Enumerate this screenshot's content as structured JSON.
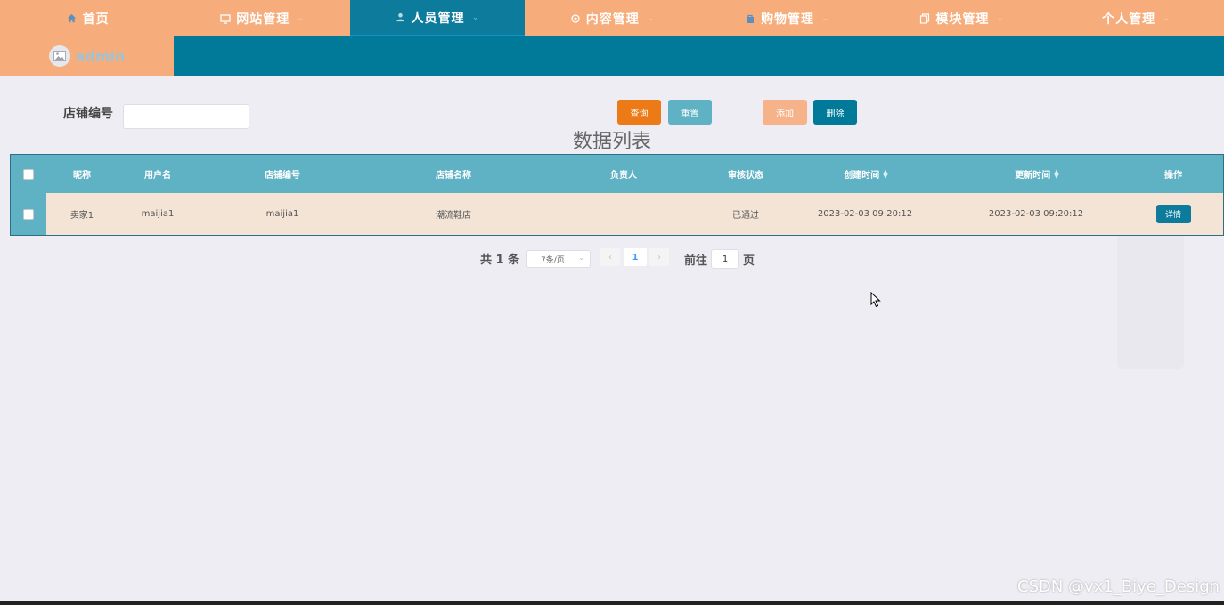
{
  "nav": [
    {
      "label": "首页",
      "icon": "home-icon",
      "active": false,
      "has_dropdown": false
    },
    {
      "label": "网站管理",
      "icon": "monitor-icon",
      "active": false,
      "has_dropdown": true
    },
    {
      "label": "人员管理",
      "icon": "user-icon",
      "active": true,
      "has_dropdown": true
    },
    {
      "label": "内容管理",
      "icon": "gear-icon",
      "active": false,
      "has_dropdown": true
    },
    {
      "label": "购物管理",
      "icon": "bag-icon",
      "active": false,
      "has_dropdown": true
    },
    {
      "label": "模块管理",
      "icon": "copy-icon",
      "active": false,
      "has_dropdown": true
    },
    {
      "label": "个人管理",
      "icon": "",
      "active": false,
      "has_dropdown": true
    }
  ],
  "user": {
    "name": "admin"
  },
  "search": {
    "label": "店铺编号",
    "value": ""
  },
  "buttons": {
    "query": "查询",
    "reset": "重置",
    "add": "添加",
    "delete": "删除"
  },
  "list_title": "数据列表",
  "table": {
    "columns": [
      "昵称",
      "用户名",
      "店铺编号",
      "店铺名称",
      "负责人",
      "审核状态",
      "创建时间",
      "更新时间",
      "操作"
    ],
    "rows": [
      {
        "nickname": "卖家1",
        "username": "maijia1",
        "shop_no": "maijia1",
        "shop_name": "潮流鞋店",
        "manager": "",
        "status": "已通过",
        "created": "2023-02-03 09:20:12",
        "updated": "2023-02-03 09:20:12",
        "action": "详情"
      }
    ]
  },
  "pagination": {
    "total_text": "共 1 条",
    "page_size": "7条/页",
    "current_page": "1",
    "goto_label": "前往",
    "goto_value": "1",
    "page_suffix": "页"
  },
  "watermark": "CSDN @vx1_Biye_Design",
  "colors": {
    "nav_bg": "#f6ad7b",
    "active_nav": "#0c7b9c",
    "header_row": "#5fb1c4",
    "data_row": "#f3e4d6",
    "query": "#ec7a17",
    "reset": "#5fb1c4",
    "add": "#f6b389",
    "delete": "#017a9a"
  }
}
